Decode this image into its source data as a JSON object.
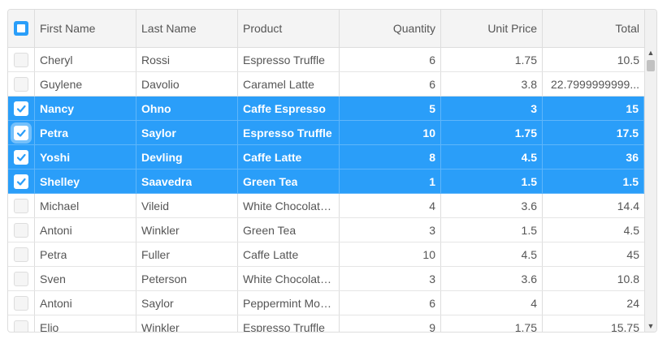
{
  "columns": [
    "First Name",
    "Last Name",
    "Product",
    "Quantity",
    "Unit Price",
    "Total"
  ],
  "rows": [
    {
      "first": "Cheryl",
      "last": "Rossi",
      "product": "Espresso Truffle",
      "qty": "6",
      "price": "1.75",
      "total": "10.5",
      "selected": false
    },
    {
      "first": "Guylene",
      "last": "Davolio",
      "product": "Caramel Latte",
      "qty": "6",
      "price": "3.8",
      "total": "22.7999999999...",
      "selected": false
    },
    {
      "first": "Nancy",
      "last": "Ohno",
      "product": "Caffe Espresso",
      "qty": "5",
      "price": "3",
      "total": "15",
      "selected": true
    },
    {
      "first": "Petra",
      "last": "Saylor",
      "product": "Espresso Truffle",
      "qty": "10",
      "price": "1.75",
      "total": "17.5",
      "selected": true
    },
    {
      "first": "Yoshi",
      "last": "Devling",
      "product": "Caffe Latte",
      "qty": "8",
      "price": "4.5",
      "total": "36",
      "selected": true
    },
    {
      "first": "Shelley",
      "last": "Saavedra",
      "product": "Green Tea",
      "qty": "1",
      "price": "1.5",
      "total": "1.5",
      "selected": true
    },
    {
      "first": "Michael",
      "last": "Vileid",
      "product": "White Chocolate...",
      "qty": "4",
      "price": "3.6",
      "total": "14.4",
      "selected": false
    },
    {
      "first": "Antoni",
      "last": "Winkler",
      "product": "Green Tea",
      "qty": "3",
      "price": "1.5",
      "total": "4.5",
      "selected": false
    },
    {
      "first": "Petra",
      "last": "Fuller",
      "product": "Caffe Latte",
      "qty": "10",
      "price": "4.5",
      "total": "45",
      "selected": false
    },
    {
      "first": "Sven",
      "last": "Peterson",
      "product": "White Chocolate...",
      "qty": "3",
      "price": "3.6",
      "total": "10.8",
      "selected": false
    },
    {
      "first": "Antoni",
      "last": "Saylor",
      "product": "Peppermint Moc...",
      "qty": "6",
      "price": "4",
      "total": "24",
      "selected": false
    },
    {
      "first": "Elio",
      "last": "Winkler",
      "product": "Espresso Truffle",
      "qty": "9",
      "price": "1.75",
      "total": "15.75",
      "selected": false
    }
  ],
  "colors": {
    "selection": "#2a9ef9",
    "header_bg": "#f4f4f4",
    "border": "#dddddd"
  }
}
